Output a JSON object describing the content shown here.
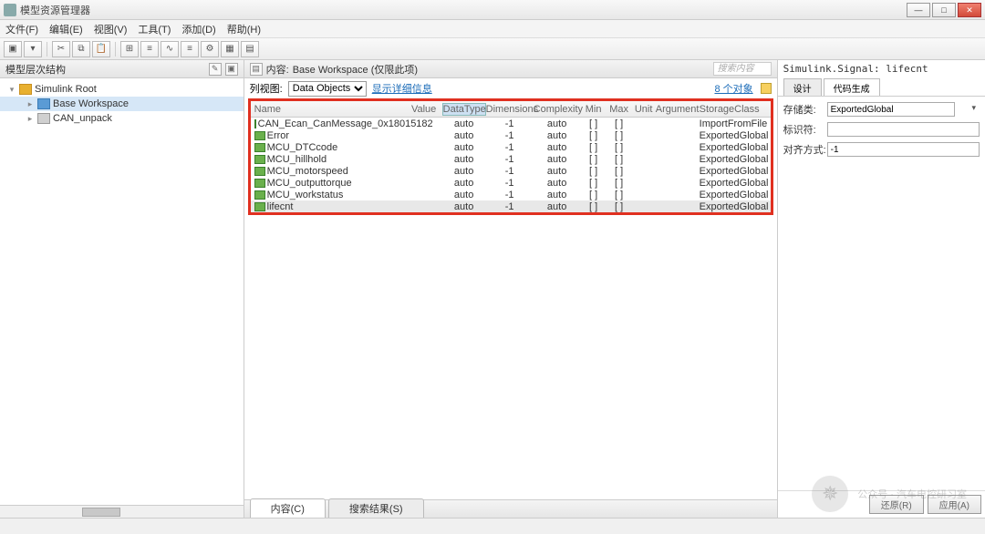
{
  "window": {
    "title": "模型资源管理器"
  },
  "menubar": [
    "文件(F)",
    "编辑(E)",
    "视图(V)",
    "工具(T)",
    "添加(D)",
    "帮助(H)"
  ],
  "left": {
    "header": "模型层次结构",
    "tree": [
      {
        "label": "Simulink Root",
        "icon": "root",
        "level": 1,
        "expanded": true
      },
      {
        "label": "Base Workspace",
        "icon": "ws",
        "level": 2,
        "expanded": false,
        "selected": true
      },
      {
        "label": "CAN_unpack",
        "icon": "block",
        "level": 2,
        "expanded": false
      }
    ]
  },
  "center": {
    "header_label": "内容:",
    "header_path": "Base Workspace (仅限此项)",
    "search_placeholder": "搜索内容",
    "filter_label": "列视图:",
    "filter_value": "Data Objects",
    "details_link": "显示详细信息",
    "obj_count": "8 个对象",
    "columns": [
      "Name",
      "Value",
      "DataType",
      "Dimensions",
      "Complexity",
      "Min",
      "Max",
      "Unit",
      "Argument",
      "StorageClass"
    ],
    "rows": [
      {
        "name": "CAN_Ecan_CanMessage_0x18015182",
        "dtype": "auto",
        "dim": "-1",
        "comp": "auto",
        "min": "[ ]",
        "max": "[ ]",
        "sc": "ImportFromFile"
      },
      {
        "name": "Error",
        "dtype": "auto",
        "dim": "-1",
        "comp": "auto",
        "min": "[ ]",
        "max": "[ ]",
        "sc": "ExportedGlobal"
      },
      {
        "name": "MCU_DTCcode",
        "dtype": "auto",
        "dim": "-1",
        "comp": "auto",
        "min": "[ ]",
        "max": "[ ]",
        "sc": "ExportedGlobal"
      },
      {
        "name": "MCU_hillhold",
        "dtype": "auto",
        "dim": "-1",
        "comp": "auto",
        "min": "[ ]",
        "max": "[ ]",
        "sc": "ExportedGlobal"
      },
      {
        "name": "MCU_motorspeed",
        "dtype": "auto",
        "dim": "-1",
        "comp": "auto",
        "min": "[ ]",
        "max": "[ ]",
        "sc": "ExportedGlobal"
      },
      {
        "name": "MCU_outputtorque",
        "dtype": "auto",
        "dim": "-1",
        "comp": "auto",
        "min": "[ ]",
        "max": "[ ]",
        "sc": "ExportedGlobal"
      },
      {
        "name": "MCU_workstatus",
        "dtype": "auto",
        "dim": "-1",
        "comp": "auto",
        "min": "[ ]",
        "max": "[ ]",
        "sc": "ExportedGlobal"
      },
      {
        "name": "lifecnt",
        "dtype": "auto",
        "dim": "-1",
        "comp": "auto",
        "min": "[ ]",
        "max": "[ ]",
        "sc": "ExportedGlobal",
        "selected": true
      }
    ],
    "tab_contents": "内容(C)",
    "tab_results": "搜索结果(S)"
  },
  "right": {
    "title": "Simulink.Signal: lifecnt",
    "tabs": [
      "设计",
      "代码生成"
    ],
    "active_tab": 1,
    "storage_label": "存储类:",
    "storage_value": "ExportedGlobal",
    "id_label": "标识符:",
    "id_value": "",
    "align_label": "对齐方式:",
    "align_value": "-1",
    "btn_revert": "还原(R)",
    "btn_apply": "应用(A)"
  },
  "watermark": "公众号 · 汽车电控研习室"
}
